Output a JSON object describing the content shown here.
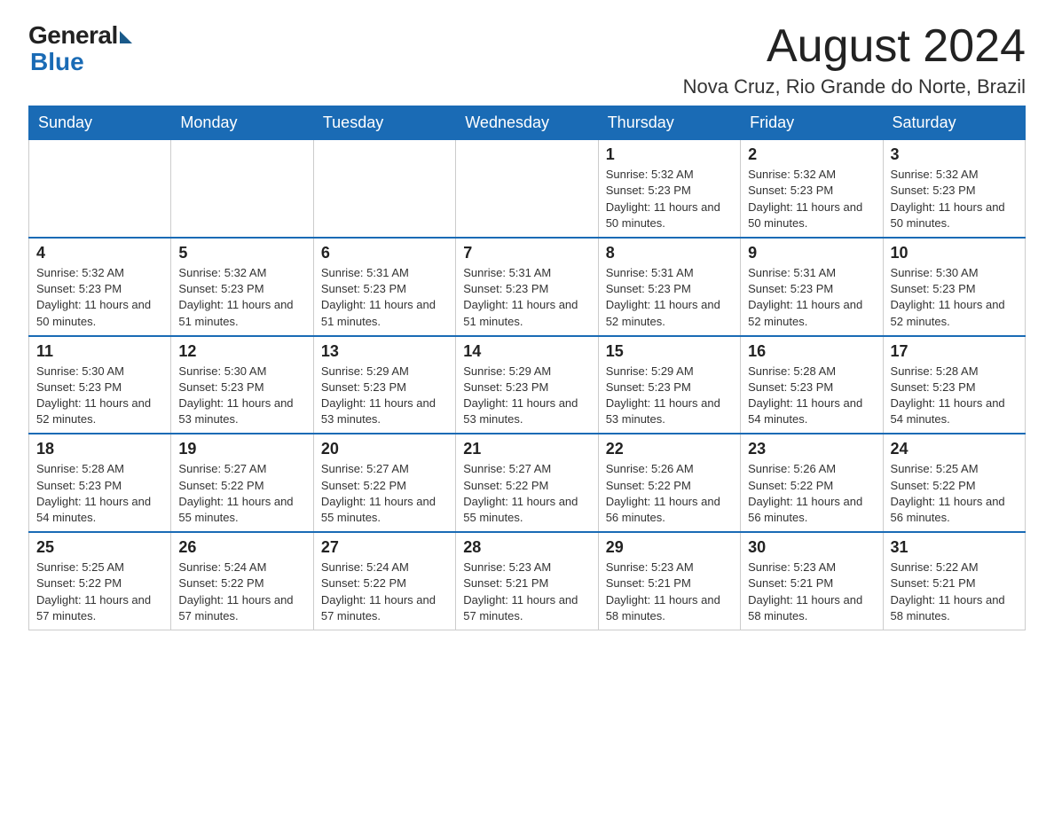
{
  "header": {
    "logo_general": "General",
    "logo_blue": "Blue",
    "title": "August 2024",
    "location": "Nova Cruz, Rio Grande do Norte, Brazil"
  },
  "days_of_week": [
    "Sunday",
    "Monday",
    "Tuesday",
    "Wednesday",
    "Thursday",
    "Friday",
    "Saturday"
  ],
  "weeks": [
    [
      {
        "day": "",
        "sunrise": "",
        "sunset": "",
        "daylight": ""
      },
      {
        "day": "",
        "sunrise": "",
        "sunset": "",
        "daylight": ""
      },
      {
        "day": "",
        "sunrise": "",
        "sunset": "",
        "daylight": ""
      },
      {
        "day": "",
        "sunrise": "",
        "sunset": "",
        "daylight": ""
      },
      {
        "day": "1",
        "sunrise": "Sunrise: 5:32 AM",
        "sunset": "Sunset: 5:23 PM",
        "daylight": "Daylight: 11 hours and 50 minutes."
      },
      {
        "day": "2",
        "sunrise": "Sunrise: 5:32 AM",
        "sunset": "Sunset: 5:23 PM",
        "daylight": "Daylight: 11 hours and 50 minutes."
      },
      {
        "day": "3",
        "sunrise": "Sunrise: 5:32 AM",
        "sunset": "Sunset: 5:23 PM",
        "daylight": "Daylight: 11 hours and 50 minutes."
      }
    ],
    [
      {
        "day": "4",
        "sunrise": "Sunrise: 5:32 AM",
        "sunset": "Sunset: 5:23 PM",
        "daylight": "Daylight: 11 hours and 50 minutes."
      },
      {
        "day": "5",
        "sunrise": "Sunrise: 5:32 AM",
        "sunset": "Sunset: 5:23 PM",
        "daylight": "Daylight: 11 hours and 51 minutes."
      },
      {
        "day": "6",
        "sunrise": "Sunrise: 5:31 AM",
        "sunset": "Sunset: 5:23 PM",
        "daylight": "Daylight: 11 hours and 51 minutes."
      },
      {
        "day": "7",
        "sunrise": "Sunrise: 5:31 AM",
        "sunset": "Sunset: 5:23 PM",
        "daylight": "Daylight: 11 hours and 51 minutes."
      },
      {
        "day": "8",
        "sunrise": "Sunrise: 5:31 AM",
        "sunset": "Sunset: 5:23 PM",
        "daylight": "Daylight: 11 hours and 52 minutes."
      },
      {
        "day": "9",
        "sunrise": "Sunrise: 5:31 AM",
        "sunset": "Sunset: 5:23 PM",
        "daylight": "Daylight: 11 hours and 52 minutes."
      },
      {
        "day": "10",
        "sunrise": "Sunrise: 5:30 AM",
        "sunset": "Sunset: 5:23 PM",
        "daylight": "Daylight: 11 hours and 52 minutes."
      }
    ],
    [
      {
        "day": "11",
        "sunrise": "Sunrise: 5:30 AM",
        "sunset": "Sunset: 5:23 PM",
        "daylight": "Daylight: 11 hours and 52 minutes."
      },
      {
        "day": "12",
        "sunrise": "Sunrise: 5:30 AM",
        "sunset": "Sunset: 5:23 PM",
        "daylight": "Daylight: 11 hours and 53 minutes."
      },
      {
        "day": "13",
        "sunrise": "Sunrise: 5:29 AM",
        "sunset": "Sunset: 5:23 PM",
        "daylight": "Daylight: 11 hours and 53 minutes."
      },
      {
        "day": "14",
        "sunrise": "Sunrise: 5:29 AM",
        "sunset": "Sunset: 5:23 PM",
        "daylight": "Daylight: 11 hours and 53 minutes."
      },
      {
        "day": "15",
        "sunrise": "Sunrise: 5:29 AM",
        "sunset": "Sunset: 5:23 PM",
        "daylight": "Daylight: 11 hours and 53 minutes."
      },
      {
        "day": "16",
        "sunrise": "Sunrise: 5:28 AM",
        "sunset": "Sunset: 5:23 PM",
        "daylight": "Daylight: 11 hours and 54 minutes."
      },
      {
        "day": "17",
        "sunrise": "Sunrise: 5:28 AM",
        "sunset": "Sunset: 5:23 PM",
        "daylight": "Daylight: 11 hours and 54 minutes."
      }
    ],
    [
      {
        "day": "18",
        "sunrise": "Sunrise: 5:28 AM",
        "sunset": "Sunset: 5:23 PM",
        "daylight": "Daylight: 11 hours and 54 minutes."
      },
      {
        "day": "19",
        "sunrise": "Sunrise: 5:27 AM",
        "sunset": "Sunset: 5:22 PM",
        "daylight": "Daylight: 11 hours and 55 minutes."
      },
      {
        "day": "20",
        "sunrise": "Sunrise: 5:27 AM",
        "sunset": "Sunset: 5:22 PM",
        "daylight": "Daylight: 11 hours and 55 minutes."
      },
      {
        "day": "21",
        "sunrise": "Sunrise: 5:27 AM",
        "sunset": "Sunset: 5:22 PM",
        "daylight": "Daylight: 11 hours and 55 minutes."
      },
      {
        "day": "22",
        "sunrise": "Sunrise: 5:26 AM",
        "sunset": "Sunset: 5:22 PM",
        "daylight": "Daylight: 11 hours and 56 minutes."
      },
      {
        "day": "23",
        "sunrise": "Sunrise: 5:26 AM",
        "sunset": "Sunset: 5:22 PM",
        "daylight": "Daylight: 11 hours and 56 minutes."
      },
      {
        "day": "24",
        "sunrise": "Sunrise: 5:25 AM",
        "sunset": "Sunset: 5:22 PM",
        "daylight": "Daylight: 11 hours and 56 minutes."
      }
    ],
    [
      {
        "day": "25",
        "sunrise": "Sunrise: 5:25 AM",
        "sunset": "Sunset: 5:22 PM",
        "daylight": "Daylight: 11 hours and 57 minutes."
      },
      {
        "day": "26",
        "sunrise": "Sunrise: 5:24 AM",
        "sunset": "Sunset: 5:22 PM",
        "daylight": "Daylight: 11 hours and 57 minutes."
      },
      {
        "day": "27",
        "sunrise": "Sunrise: 5:24 AM",
        "sunset": "Sunset: 5:22 PM",
        "daylight": "Daylight: 11 hours and 57 minutes."
      },
      {
        "day": "28",
        "sunrise": "Sunrise: 5:23 AM",
        "sunset": "Sunset: 5:21 PM",
        "daylight": "Daylight: 11 hours and 57 minutes."
      },
      {
        "day": "29",
        "sunrise": "Sunrise: 5:23 AM",
        "sunset": "Sunset: 5:21 PM",
        "daylight": "Daylight: 11 hours and 58 minutes."
      },
      {
        "day": "30",
        "sunrise": "Sunrise: 5:23 AM",
        "sunset": "Sunset: 5:21 PM",
        "daylight": "Daylight: 11 hours and 58 minutes."
      },
      {
        "day": "31",
        "sunrise": "Sunrise: 5:22 AM",
        "sunset": "Sunset: 5:21 PM",
        "daylight": "Daylight: 11 hours and 58 minutes."
      }
    ]
  ]
}
